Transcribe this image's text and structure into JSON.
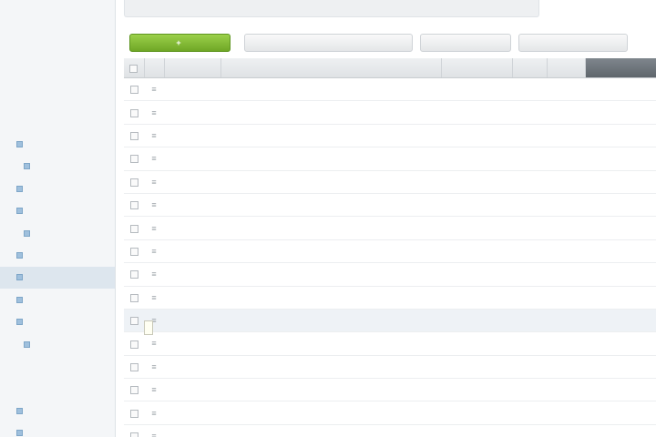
{
  "sidebar": {
    "items": [
      {
        "label": "",
        "level": 1,
        "icon": false,
        "active": false
      },
      {
        "label": "",
        "level": 1,
        "icon": false,
        "active": false
      },
      {
        "label": "",
        "level": 1,
        "icon": false,
        "active": false
      },
      {
        "label": "",
        "level": 1,
        "icon": false,
        "active": false
      },
      {
        "label": "",
        "level": 1,
        "icon": false,
        "active": false
      },
      {
        "label": "",
        "level": 1,
        "icon": false,
        "active": false
      },
      {
        "label": "",
        "level": 2,
        "icon": true,
        "active": false
      },
      {
        "label": "",
        "level": 3,
        "icon": true,
        "active": false
      },
      {
        "label": "",
        "level": 2,
        "icon": true,
        "active": false
      },
      {
        "label": "",
        "level": 2,
        "icon": true,
        "active": false
      },
      {
        "label": "",
        "level": 3,
        "icon": true,
        "active": false
      },
      {
        "label": "",
        "level": 2,
        "icon": true,
        "active": false
      },
      {
        "label": "",
        "level": 2,
        "icon": true,
        "active": true
      },
      {
        "label": "",
        "level": 2,
        "icon": true,
        "active": false
      },
      {
        "label": "",
        "level": 2,
        "icon": true,
        "active": false
      },
      {
        "label": "",
        "level": 3,
        "icon": true,
        "active": false
      },
      {
        "label": "",
        "level": 1,
        "icon": false,
        "active": false
      },
      {
        "label": "",
        "level": 1,
        "icon": false,
        "active": false
      },
      {
        "label": "",
        "level": 2,
        "icon": true,
        "active": false
      },
      {
        "label": "",
        "level": 2,
        "icon": true,
        "active": false
      }
    ]
  },
  "toolbar": {
    "add_label": "",
    "buttons": [
      {
        "label": "",
        "width": 185
      },
      {
        "label": "",
        "width": 100
      },
      {
        "label": "",
        "width": 120
      }
    ]
  },
  "table": {
    "columns": [
      "",
      "",
      "",
      "",
      "",
      "",
      "",
      ""
    ],
    "sorted_column": 7,
    "hover_row": 10,
    "rows": [
      [
        "",
        "",
        "",
        "",
        "",
        "",
        "",
        ""
      ],
      [
        "",
        "",
        "",
        "",
        "",
        "",
        "",
        ""
      ],
      [
        "",
        "",
        "",
        "",
        "",
        "",
        "",
        ""
      ],
      [
        "",
        "",
        "",
        "",
        "",
        "",
        "",
        ""
      ],
      [
        "",
        "",
        "",
        "",
        "",
        "",
        "",
        ""
      ],
      [
        "",
        "",
        "",
        "",
        "",
        "",
        "",
        ""
      ],
      [
        "",
        "",
        "",
        "",
        "",
        "",
        "",
        ""
      ],
      [
        "",
        "",
        "",
        "",
        "",
        "",
        "",
        ""
      ],
      [
        "",
        "",
        "",
        "",
        "",
        "",
        "",
        ""
      ],
      [
        "",
        "",
        "",
        "",
        "",
        "",
        "",
        ""
      ],
      [
        "",
        "",
        "",
        "",
        "",
        "",
        "",
        ""
      ],
      [
        "",
        "",
        "",
        "",
        "",
        "",
        "",
        ""
      ],
      [
        "",
        "",
        "",
        "",
        "",
        "",
        "",
        ""
      ],
      [
        "",
        "",
        "",
        "",
        "",
        "",
        "",
        ""
      ],
      [
        "",
        "",
        "",
        "",
        "",
        "",
        "",
        ""
      ],
      [
        "",
        "",
        "",
        "",
        "",
        "",
        "",
        ""
      ]
    ]
  },
  "tooltip": {
    "text": ""
  },
  "colors": {
    "accent_green": "#7fb834",
    "link_blue": "#2f5fb0",
    "sorted_header": "#6a7177",
    "hover_row": "#eef2f6",
    "active_nav": "#dde6ee"
  }
}
